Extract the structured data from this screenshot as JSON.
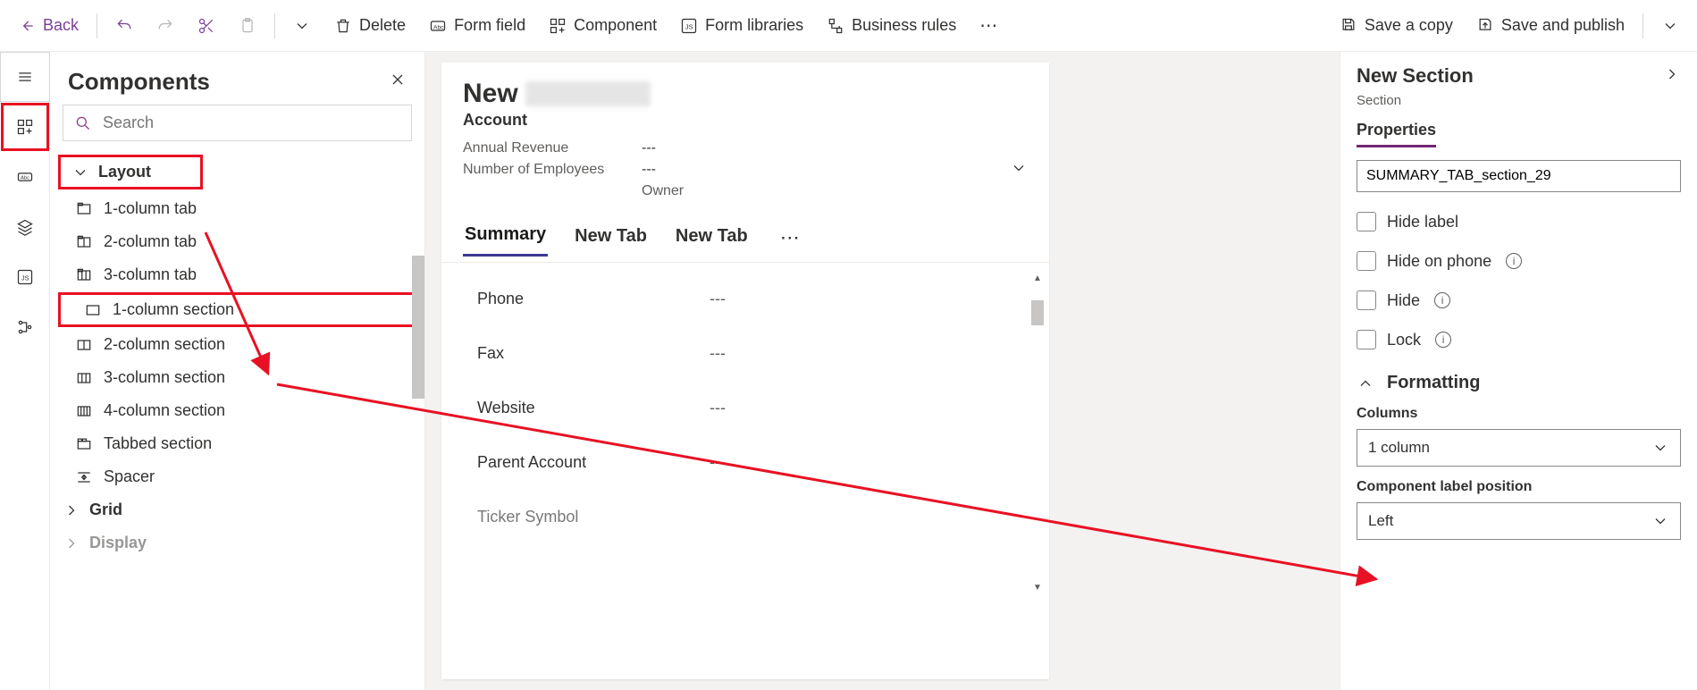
{
  "toolbar": {
    "back": "Back",
    "delete": "Delete",
    "form_field": "Form field",
    "component": "Component",
    "form_libraries": "Form libraries",
    "business_rules": "Business rules",
    "save_copy": "Save a copy",
    "save_publish": "Save and publish"
  },
  "panel": {
    "title": "Components",
    "search_placeholder": "Search",
    "groups": {
      "layout": {
        "label": "Layout",
        "items": [
          "1-column tab",
          "2-column tab",
          "3-column tab",
          "1-column section",
          "2-column section",
          "3-column section",
          "4-column section",
          "Tabbed section",
          "Spacer"
        ]
      },
      "grid": {
        "label": "Grid"
      },
      "display": {
        "label": "Display"
      }
    }
  },
  "form": {
    "title": "New",
    "entity": "Account",
    "header_fields": [
      {
        "label": "Annual Revenue",
        "value": "---"
      },
      {
        "label": "Number of Employees",
        "value": "---"
      },
      {
        "label": "Owner",
        "value": ""
      }
    ],
    "tabs": [
      "Summary",
      "New Tab",
      "New Tab"
    ],
    "active_tab": 0,
    "body_fields": [
      {
        "label": "Phone",
        "value": "---"
      },
      {
        "label": "Fax",
        "value": "---"
      },
      {
        "label": "Website",
        "value": "---"
      },
      {
        "label": "Parent Account",
        "value": "---"
      },
      {
        "label": "Ticker Symbol",
        "value": ""
      }
    ]
  },
  "props": {
    "title": "New Section",
    "subtitle": "Section",
    "tab": "Properties",
    "name_value": "SUMMARY_TAB_section_29",
    "checks": {
      "hide_label": "Hide label",
      "hide_on_phone": "Hide on phone",
      "hide": "Hide",
      "lock": "Lock"
    },
    "formatting": {
      "header": "Formatting",
      "columns_label": "Columns",
      "columns_value": "1 column",
      "label_pos_label": "Component label position",
      "label_pos_value": "Left"
    }
  }
}
